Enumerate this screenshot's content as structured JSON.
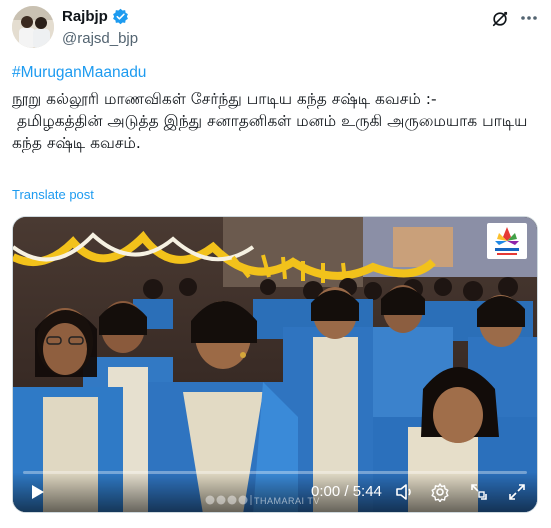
{
  "author": {
    "display_name": "Rajbjp",
    "handle": "@rajsd_bjp",
    "avatar_icon": "profile-photo",
    "verified_color": "#1d9bf0"
  },
  "post": {
    "hashtag": "#MuruganMaanadu",
    "text": "நூறு கல்லூரி மாணவிகள் சேர்ந்து பாடிய கந்த சஷ்டி கவசம் :-\n தமிழகத்தின் அடுத்த இந்து சனாதனிகள் மனம் உருகி அருமையாக பாடிய கந்த சஷ்டி கவசம்.",
    "translate_label": "Translate post"
  },
  "video": {
    "current_time": "0:00",
    "duration": "5:44",
    "time_display": "0:00 / 5:44",
    "progress_fraction": 0.0,
    "watermark": "THAMARAI TV",
    "accent_color": "#1d9bf0",
    "icons": [
      "play-icon",
      "volume-icon",
      "settings-icon",
      "pip-icon",
      "fullscreen-icon"
    ]
  }
}
